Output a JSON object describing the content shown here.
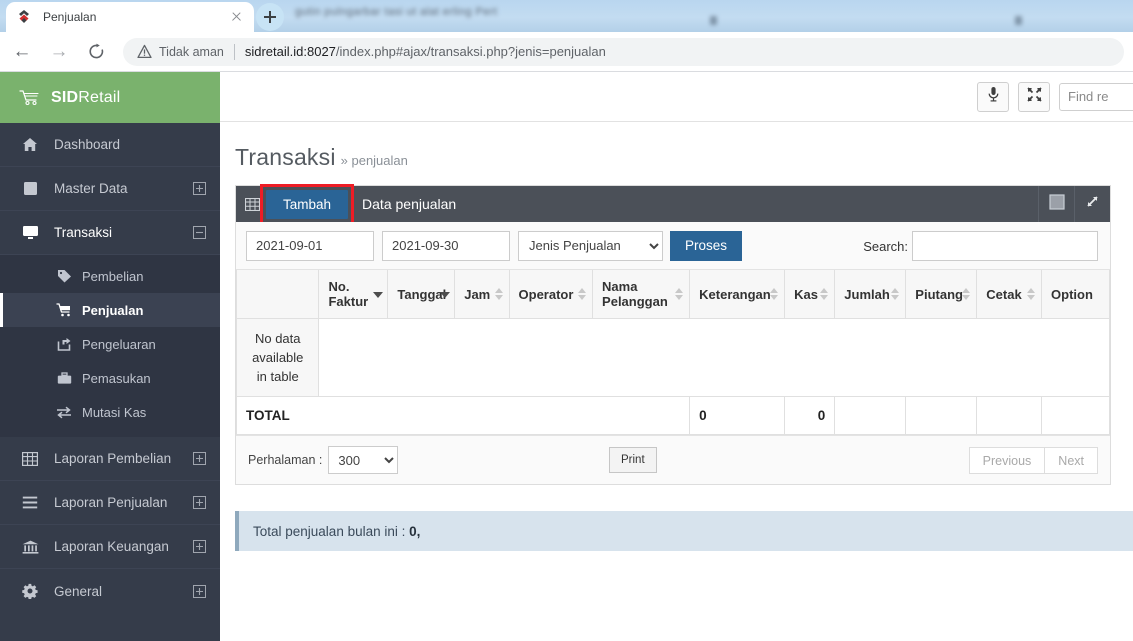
{
  "browser": {
    "tab_title": "Penjualan",
    "tab_favicon_icon": "sid-logo-icon",
    "new_tab_icon": "plus-icon",
    "back_icon": "arrow-left-icon",
    "forward_icon": "arrow-right-icon",
    "reload_icon": "reload-icon",
    "security_icon": "warning-triangle-icon",
    "security_label": "Tidak aman",
    "url_host": "sidretail.id:8027",
    "url_path": "/index.php#ajax/transaksi.php?jenis=penjualan",
    "close_tab_icon": "close-icon"
  },
  "sidebar": {
    "brand": {
      "icon": "shopping-cart-icon",
      "bold": "SID",
      "rest": "Retail"
    },
    "items": [
      {
        "label": "Dashboard",
        "icon": "home-icon",
        "expandable": false
      },
      {
        "label": "Master Data",
        "icon": "box-icon",
        "expandable": true,
        "toggle": "plus-icon"
      },
      {
        "label": "Transaksi",
        "icon": "monitor-icon",
        "expandable": true,
        "toggle": "minus-icon",
        "open": true
      }
    ],
    "sub_items": [
      {
        "label": "Pembelian",
        "icon": "tag-icon",
        "active": false
      },
      {
        "label": "Penjualan",
        "icon": "cart-icon",
        "active": true
      },
      {
        "label": "Pengeluaran",
        "icon": "share-icon",
        "active": false
      },
      {
        "label": "Pemasukan",
        "icon": "briefcase-icon",
        "active": false
      },
      {
        "label": "Mutasi Kas",
        "icon": "exchange-icon",
        "active": false
      }
    ],
    "items_bottom": [
      {
        "label": "Laporan Pembelian",
        "icon": "table-icon",
        "toggle": "plus-icon"
      },
      {
        "label": "Laporan Penjualan",
        "icon": "list-icon",
        "toggle": "plus-icon"
      },
      {
        "label": "Laporan Keuangan",
        "icon": "bank-icon",
        "toggle": "plus-icon"
      },
      {
        "label": "General",
        "icon": "gear-icon",
        "toggle": "plus-icon"
      }
    ]
  },
  "topbar": {
    "mic_icon": "microphone-icon",
    "expand_icon": "fullscreen-icon",
    "find_placeholder": "Find re"
  },
  "page": {
    "title": "Transaksi",
    "breadcrumb": "» penjualan"
  },
  "panel": {
    "grid_icon": "grid-icon",
    "add_label": "Tambah",
    "caption": "Data penjualan",
    "minimize_icon": "square-icon",
    "expand_icon": "expand-arrows-icon",
    "highlight_color": "#ee1c25",
    "accent_color": "#2a6496"
  },
  "filter": {
    "date_from": "2021-09-01",
    "date_to": "2021-09-30",
    "jenis_selected": "Jenis Penjualan",
    "jenis_options": [
      "Jenis Penjualan"
    ],
    "process_label": "Proses",
    "search_label": "Search:",
    "search_value": "",
    "search_placeholder": ""
  },
  "table": {
    "columns": [
      {
        "label": "",
        "sort": "none"
      },
      {
        "label": "No. Faktur",
        "sort": "desc"
      },
      {
        "label": "Tanggal",
        "sort": "desc"
      },
      {
        "label": "Jam",
        "sort": "both"
      },
      {
        "label": "Operator",
        "sort": "both"
      },
      {
        "label": "Nama Pelanggan",
        "sort": "both"
      },
      {
        "label": "Keterangan",
        "sort": "both"
      },
      {
        "label": "Kas",
        "sort": "both"
      },
      {
        "label": "Jumlah",
        "sort": "both"
      },
      {
        "label": "Piutang",
        "sort": "both"
      },
      {
        "label": "Cetak",
        "sort": "both"
      },
      {
        "label": "Option",
        "sort": "none"
      }
    ],
    "empty_message": "No data available in table",
    "rows": [],
    "total_label": "TOTAL",
    "total_keterangan": "0",
    "total_kas": "0",
    "total_jumlah": "",
    "total_piutang": "",
    "total_cetak": "",
    "total_option": ""
  },
  "footer": {
    "per_page_label": "Perhalaman :",
    "per_page_value": "300",
    "per_page_options": [
      "300"
    ],
    "print_label": "Print",
    "previous_label": "Previous",
    "next_label": "Next"
  },
  "info": {
    "text": "Total penjualan bulan ini : ",
    "value": "0,"
  }
}
